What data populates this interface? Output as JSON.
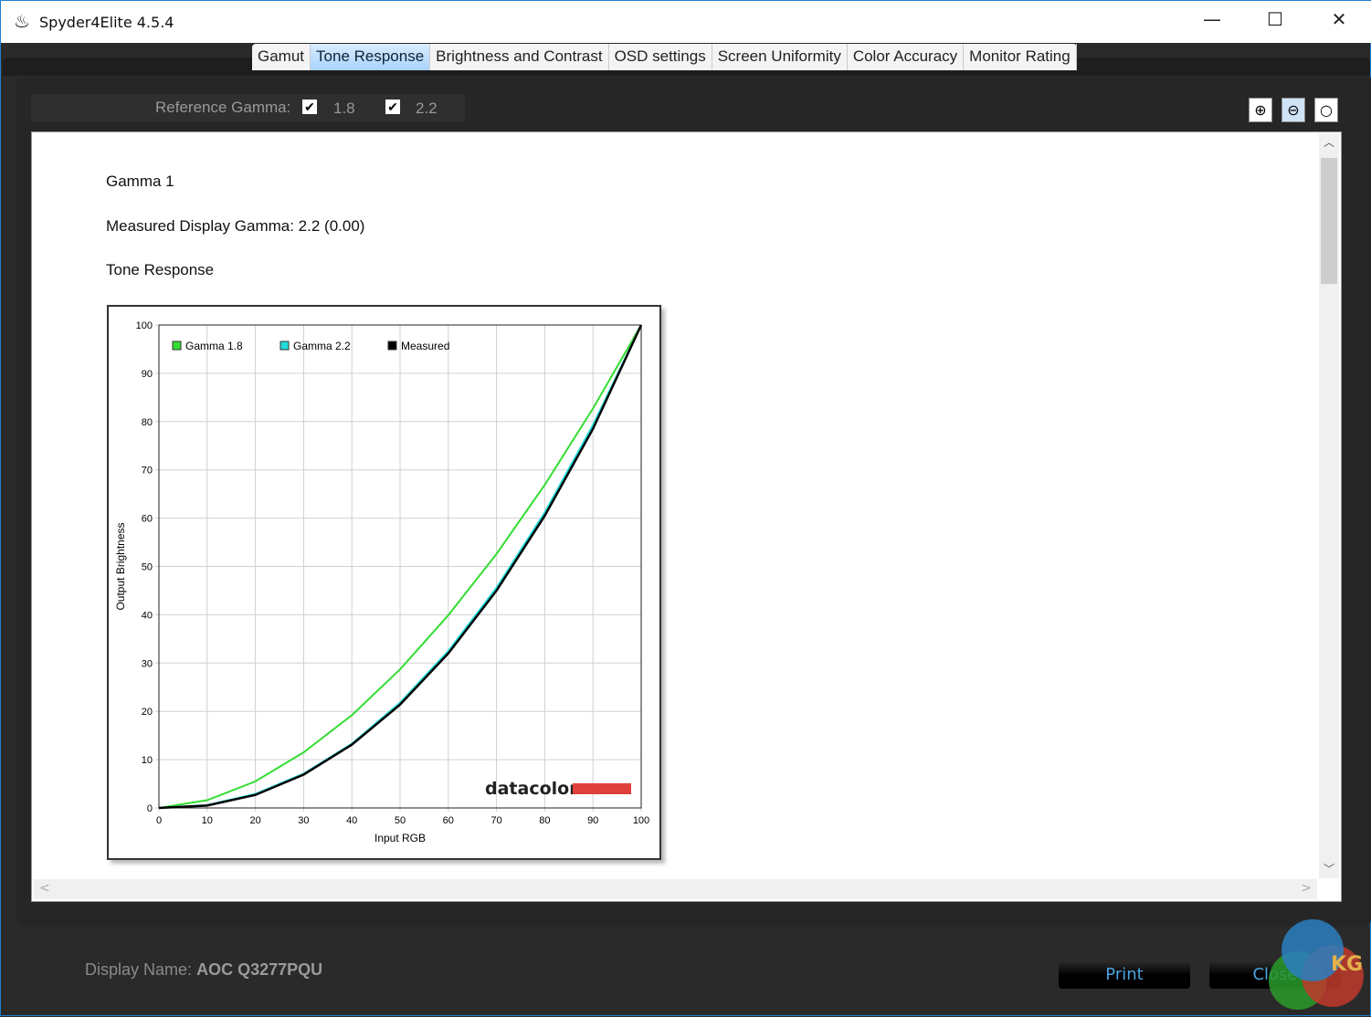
{
  "window": {
    "title": "Spyder4Elite 4.5.4"
  },
  "tabs": [
    {
      "label": "Gamut"
    },
    {
      "label": "Tone Response",
      "active": true
    },
    {
      "label": "Brightness and Contrast"
    },
    {
      "label": "OSD settings"
    },
    {
      "label": "Screen Uniformity"
    },
    {
      "label": "Color Accuracy"
    },
    {
      "label": "Monitor Rating"
    }
  ],
  "reference": {
    "label": "Reference Gamma:",
    "g1": "1.8",
    "g1_checked": true,
    "g2": "2.2",
    "g2_checked": true
  },
  "report": {
    "heading": "Gamma 1",
    "measured": "Measured Display Gamma: 2.2 (0.00)",
    "section": "Tone Response",
    "brand": "datacolor"
  },
  "chart_data": {
    "type": "line",
    "xlabel": "Input RGB",
    "ylabel": "Output Brightness",
    "xlim": [
      0,
      100
    ],
    "ylim": [
      0,
      100
    ],
    "grid": true,
    "legend": "top-left",
    "x": [
      0,
      10,
      20,
      30,
      40,
      50,
      60,
      70,
      80,
      90,
      100
    ],
    "xticks": [
      "0",
      "10",
      "20",
      "30",
      "40",
      "50",
      "60",
      "70",
      "80",
      "90",
      "100"
    ],
    "yticks": [
      "0",
      "10",
      "20",
      "30",
      "40",
      "50",
      "60",
      "70",
      "80",
      "90",
      "100"
    ],
    "series": [
      {
        "name": "Gamma 1.8",
        "color": "#33dd33",
        "values": [
          0,
          1.6,
          5.5,
          11.5,
          19.2,
          28.7,
          39.9,
          52.6,
          66.9,
          82.7,
          100
        ]
      },
      {
        "name": "Gamma 2.2",
        "color": "#22dddd",
        "values": [
          0,
          0.6,
          2.9,
          7.1,
          13.3,
          21.8,
          32.5,
          45.6,
          61.2,
          79.3,
          100
        ]
      },
      {
        "name": "Measured",
        "color": "#000000",
        "values": [
          0,
          0.5,
          2.7,
          6.9,
          13.1,
          21.4,
          32.0,
          45.0,
          60.5,
          78.5,
          100
        ]
      }
    ]
  },
  "footer": {
    "display_label": "Display Name:",
    "display_name": "AOC Q3277PQU",
    "print": "Print",
    "close": "Close"
  },
  "watermark": "KG"
}
